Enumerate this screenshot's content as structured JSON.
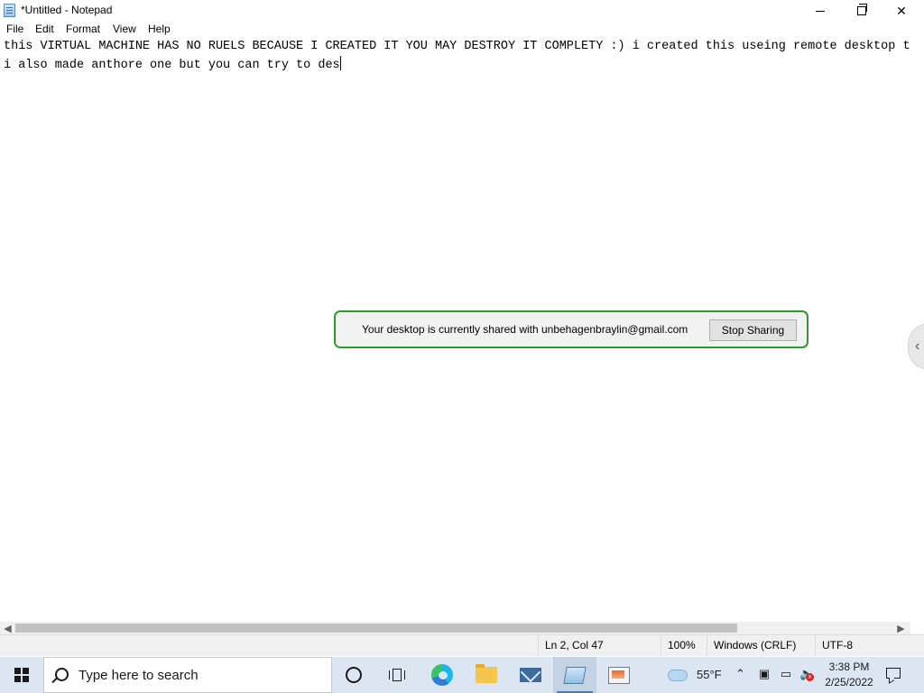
{
  "window": {
    "title": "*Untitled - Notepad",
    "icon": "notepad-icon",
    "controls": [
      "minimize-icon",
      "restore-icon",
      "close-icon"
    ]
  },
  "menu": {
    "file": "File",
    "edit": "Edit",
    "format": "Format",
    "view": "View",
    "help": "Help"
  },
  "editor": {
    "line1": "this VIRTUAL MACHINE HAS NO RUELS BECAUSE I CREATED IT YOU MAY DESTROY IT COMPLETY :) i created this useing remote desktop tr",
    "line2": "i also made anthore one but you can try to des"
  },
  "statusbar": {
    "position": "Ln 2, Col 47",
    "zoom": "100%",
    "line_ending": "Windows (CRLF)",
    "encoding": "UTF-8"
  },
  "sharing": {
    "message": "Your desktop is currently shared with unbehagenbraylin@gmail.com",
    "button": "Stop Sharing",
    "border_color": "#2e9a2e"
  },
  "taskbar": {
    "search_placeholder": "Type here to search",
    "apps": [
      "cortana-icon",
      "task-view-icon",
      "edge-icon",
      "file-explorer-icon",
      "mail-icon",
      "notepad-icon",
      "remote-desktop-icon"
    ],
    "weather": "55°F",
    "time": "3:38 PM",
    "date": "2/25/2022",
    "background": "#dbe6f2"
  }
}
